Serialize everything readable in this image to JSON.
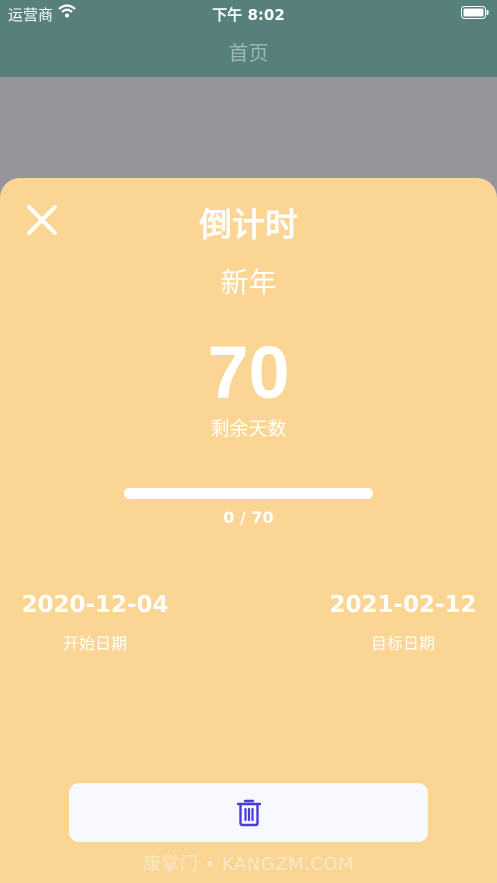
{
  "status_bar": {
    "carrier": "运营商",
    "time": "下午 8:02"
  },
  "nav": {
    "title": "首页"
  },
  "sheet": {
    "title": "倒计时",
    "event_name": "新年",
    "days_remaining": "70",
    "days_label": "剩余天数",
    "progress": {
      "text": "0 / 70",
      "fraction": 0
    },
    "start": {
      "date": "2020-12-04",
      "label": "开始日期"
    },
    "target": {
      "date": "2021-02-12",
      "label": "目标日期"
    },
    "delete_icon": "trash-icon",
    "close_icon": "close-icon"
  },
  "watermark": "康掌门 • KANGZM.COM",
  "colors": {
    "nav_background": "#57807c",
    "sheet_background": "#fbd593",
    "button_background": "#f8f8ff",
    "trash_icon": "#4a3bd6"
  }
}
